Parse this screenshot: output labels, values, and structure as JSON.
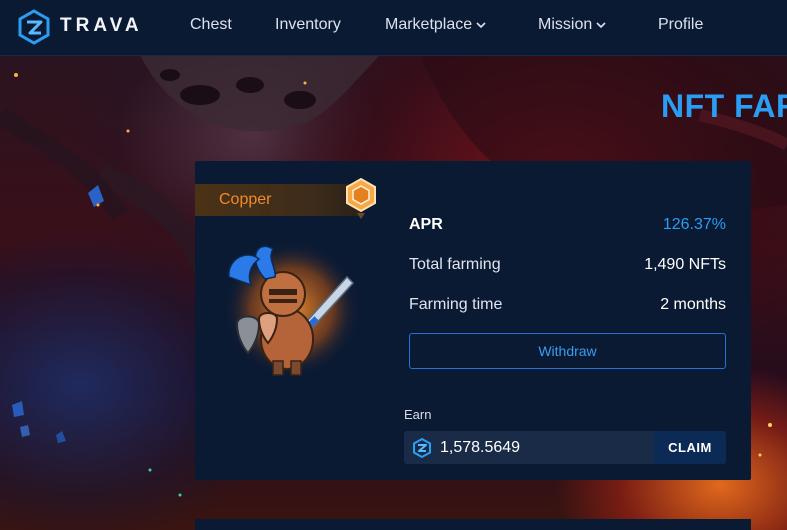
{
  "header": {
    "brand": "TRAVA",
    "nav": [
      {
        "label": "Chest"
      },
      {
        "label": "Inventory"
      },
      {
        "label": "Marketplace"
      },
      {
        "label": "Mission"
      },
      {
        "label": "Profile"
      }
    ]
  },
  "page": {
    "heading": "NFT FAR"
  },
  "card": {
    "rank": "Copper",
    "rank_badge_icon": "hexagon-badge-icon",
    "avatar_icon": "knight-avatar",
    "stats": {
      "apr_label": "APR",
      "apr_value": "126.37%",
      "total_label": "Total farming",
      "total_value": "1,490 NFTs",
      "time_label": "Farming time",
      "time_value": "2 months"
    },
    "withdraw_label": "Withdraw",
    "earn_label": "Earn",
    "earn_value": "1,578.5649",
    "earn_token_icon": "trava-token-icon",
    "claim_label": "CLAIM"
  },
  "colors": {
    "accent": "#2a9df4",
    "header_bg": "#0b1a33",
    "rank_text": "#f08a2a"
  }
}
